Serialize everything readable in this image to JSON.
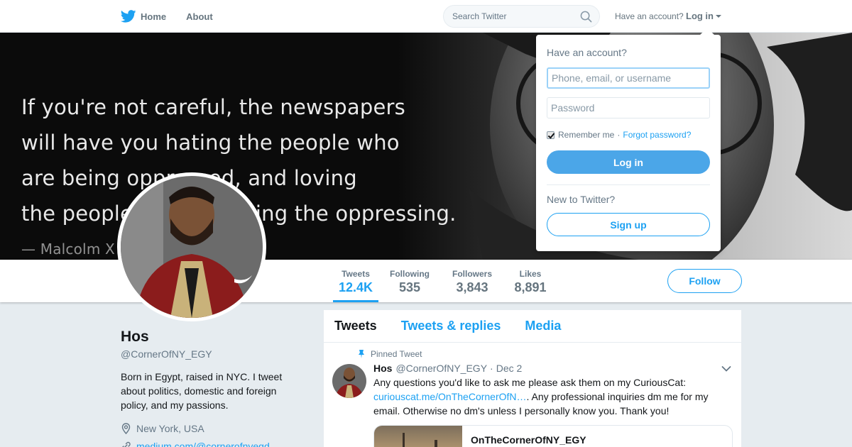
{
  "nav": {
    "home_label": "Home",
    "about_label": "About",
    "search_placeholder": "Search Twitter",
    "account_prompt": "Have an account?",
    "login_label": "Log in"
  },
  "banner": {
    "quote_lines": [
      "If you're not careful, the newspapers",
      "will have you hating the people who",
      "are being oppressed, and loving",
      "the people who are doing the oppressing.",
      "— Malcolm X"
    ]
  },
  "profile": {
    "name": "Hos",
    "handle": "@CornerOfNY_EGY",
    "bio": "Born in Egypt, raised in NYC. I tweet about politics, domestic and foreign policy, and my passions.",
    "location": "New York, USA",
    "website": "medium.com/@cornerofnyegd"
  },
  "stats": [
    {
      "label": "Tweets",
      "value": "12.4K"
    },
    {
      "label": "Following",
      "value": "535"
    },
    {
      "label": "Followers",
      "value": "3,843"
    },
    {
      "label": "Likes",
      "value": "8,891"
    }
  ],
  "follow_label": "Follow",
  "timeline": {
    "tabs": [
      "Tweets",
      "Tweets & replies",
      "Media"
    ],
    "pinned_label": "Pinned Tweet",
    "tweet": {
      "name": "Hos",
      "handle": "@CornerOfNY_EGY",
      "separator": "·",
      "date": "Dec 2",
      "text_before": "Any questions you'd like to ask me please ask them on my CuriousCat: ",
      "link": "curiouscat.me/OnTheCornerOfN…",
      "text_after": ". Any professional inquiries dm me for my email. Otherwise no dm's unless I personally know you. Thank you!",
      "card_title": "OnTheCornerOfNY_EGY"
    }
  },
  "login_dropdown": {
    "title": "Have an account?",
    "username_placeholder": "Phone, email, or username",
    "password_placeholder": "Password",
    "remember_label": "Remember me",
    "separator": "·",
    "forgot_label": "Forgot password?",
    "login_button": "Log in",
    "new_prompt": "New to Twitter?",
    "signup_button": "Sign up"
  },
  "colors": {
    "accent": "#1da1f2",
    "background": "#e6ecf0",
    "muted_text": "#657786"
  }
}
